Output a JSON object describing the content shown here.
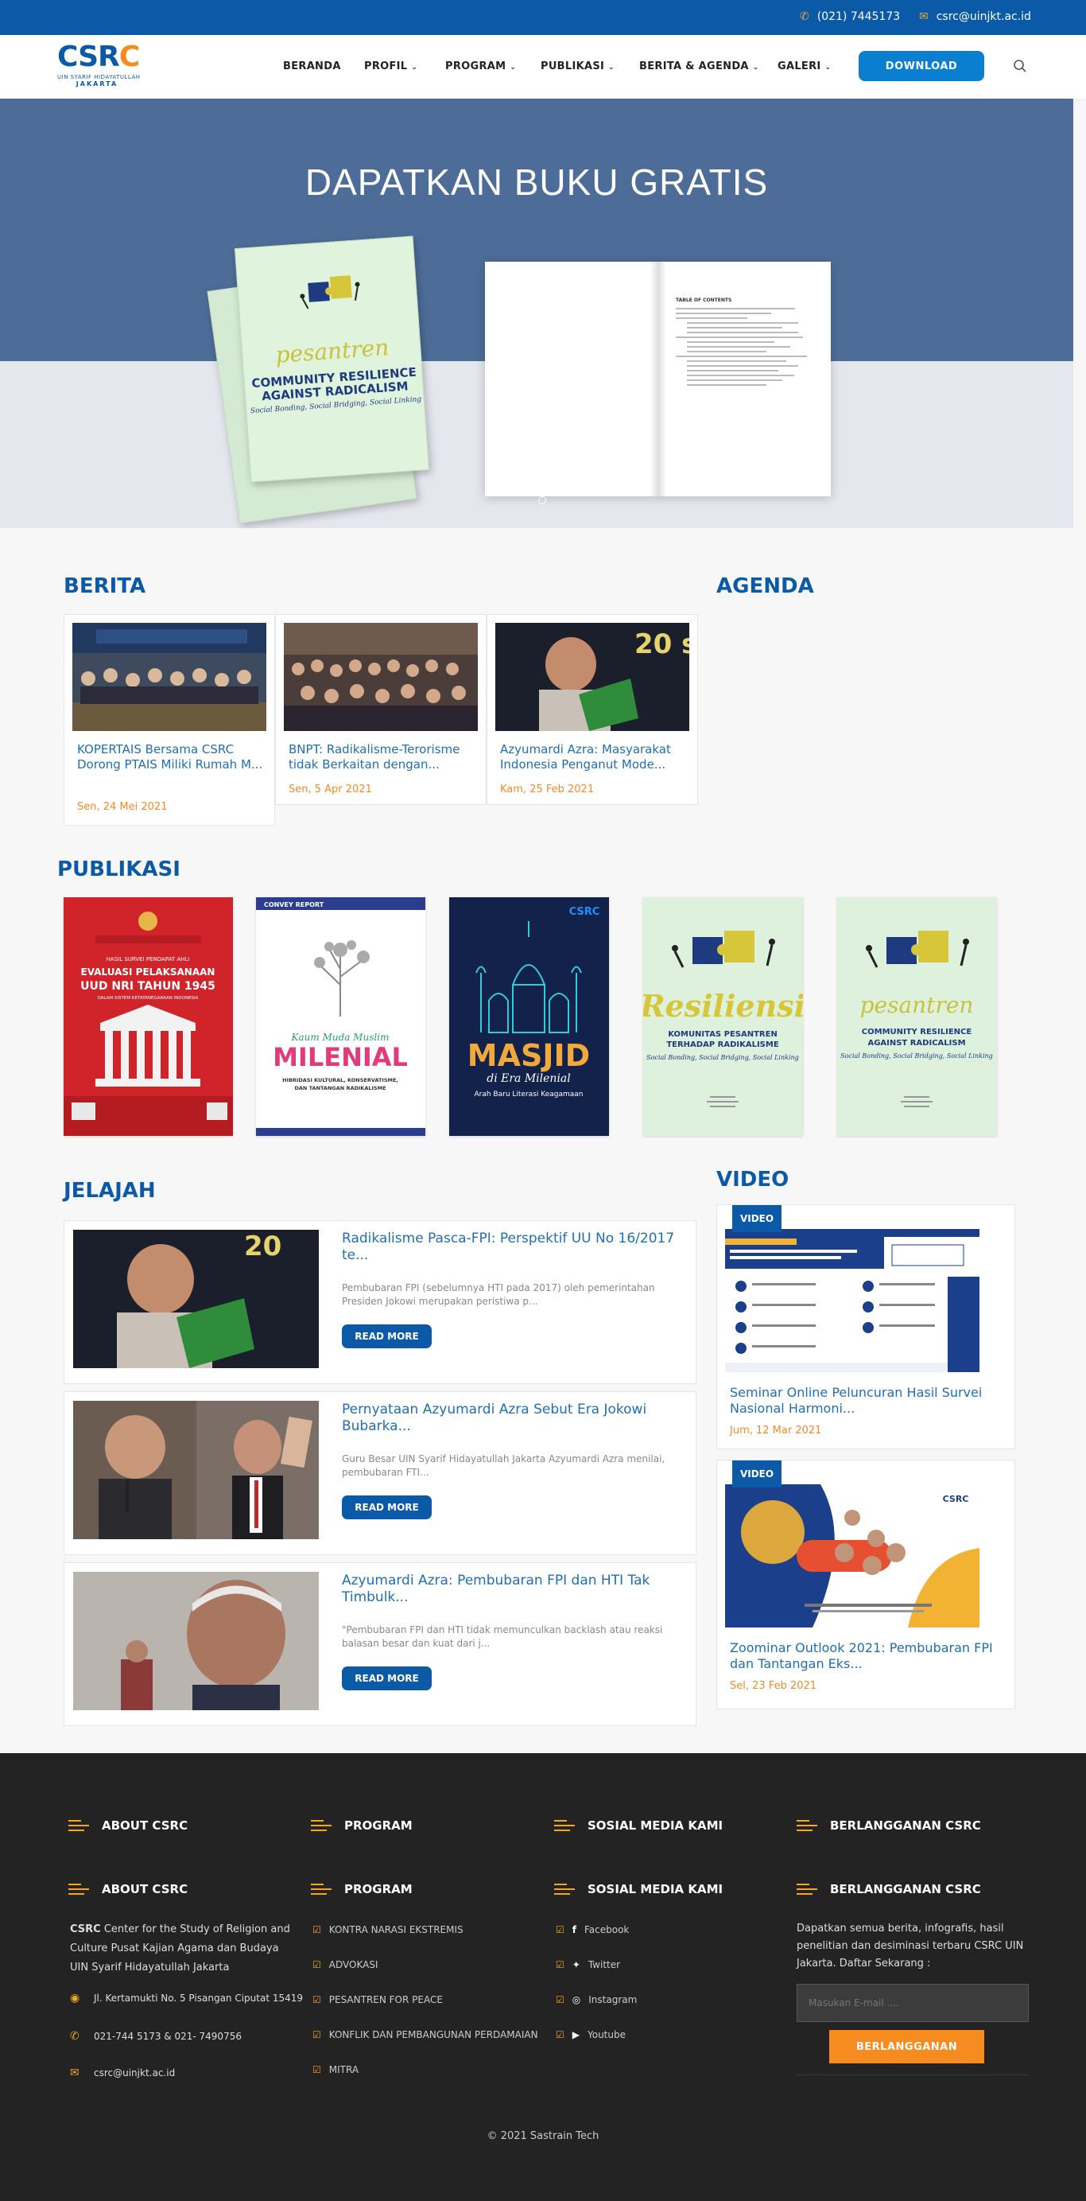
{
  "topbar": {
    "phone": "(021) 7445173",
    "email": "csrc@uinjkt.ac.id"
  },
  "logo": {
    "part1": "CSR",
    "part2": "C",
    "sub": "UIN SYARIF HIDAYATULLAH",
    "sub2": "JAKARTA"
  },
  "nav": {
    "items": [
      {
        "label": "BERANDA",
        "dropdown": false
      },
      {
        "label": "PROFIL",
        "dropdown": true
      },
      {
        "label": "PROGRAM",
        "dropdown": true
      },
      {
        "label": "PUBLIKASI",
        "dropdown": true
      },
      {
        "label": "BERITA & AGENDA",
        "dropdown": true
      },
      {
        "label": "GALERI",
        "dropdown": true
      }
    ],
    "download_label": "DOWNLOAD"
  },
  "hero": {
    "title": "DAPATKAN BUKU GRATIS",
    "book_line1": "pesantren",
    "book_line2": "COMMUNITY RESILIENCE",
    "book_line3": "AGAINST RADICALISM",
    "book_tagline": "Social Bonding, Social Bridging, Social Linking",
    "toc_title": "TABLE OF CONTENTS"
  },
  "berita": {
    "heading": "BERITA",
    "items": [
      {
        "title": "KOPERTAIS Bersama CSRC Dorong PTAIS Miliki Rumah M...",
        "date": "Sen, 24 Mei 2021"
      },
      {
        "title": "BNPT: Radikalisme-Terorisme tidak Berkaitan dengan...",
        "date": "Sen, 5 Apr 2021"
      },
      {
        "title": "Azyumardi Azra: Masyarakat Indonesia Penganut Mode...",
        "date": "Kam, 25 Feb 2021"
      }
    ]
  },
  "agenda": {
    "heading": "AGENDA"
  },
  "publikasi": {
    "heading": "PUBLIKASI",
    "covers": [
      {
        "top": "HASIL SURVEI PENDAPAT AHLI",
        "title": "EVALUASI PELAKSANAAN UUD NRI TAHUN 1945",
        "sub": "DALAM SISTEM KETATANEGARAAN INDONESIA"
      },
      {
        "top": "CONVEY REPORT",
        "title": "MILENIAL",
        "script": "Kaum Muda Muslim",
        "sub": "HIBRIDASI KULTURAL, KONSERVATISME, DAN TANTANGAN RADIKALISME"
      },
      {
        "title": "MASJID",
        "script": "di Era Milenial",
        "sub": "Arah Baru Literasi Keagamaan"
      },
      {
        "title": "Resiliensi",
        "sub": "KOMUNITAS PESANTREN TERHADAP RADIKALISME"
      },
      {
        "title": "pesantren",
        "sub": "COMMUNITY RESILIENCE AGAINST RADICALISM"
      }
    ]
  },
  "jelajah": {
    "heading": "JELAJAH",
    "read_more": "READ MORE",
    "items": [
      {
        "title": "Radikalisme Pasca-FPI: Perspektif UU No 16/2017 te...",
        "excerpt": "Pembubaran FPI (sebelumnya HTI pada 2017) oleh pemerintahan Presiden Jokowi merupakan peristiwa p..."
      },
      {
        "title": "Pernyataan Azyumardi Azra Sebut Era Jokowi Bubarka...",
        "excerpt": "Guru Besar UIN Syarif Hidayatullah Jakarta Azyumardi Azra menilai, pembubaran FTI..."
      },
      {
        "title": "Azyumardi Azra: Pembubaran FPI dan HTI Tak Timbulk...",
        "excerpt": "\"Pembubaran FPI dan HTI tidak memunculkan backlash atau reaksi balasan besar dan kuat dari j..."
      }
    ]
  },
  "video": {
    "heading": "VIDEO",
    "badge": "VIDEO",
    "items": [
      {
        "title": "Seminar Online Peluncuran Hasil Survei Nasional Harmoni...",
        "date": "Jum, 12 Mar 2021"
      },
      {
        "title": "Zoominar Outlook 2021: Pembubaran FPI dan Tantangan Eks...",
        "date": "Sel, 23 Feb 2021"
      }
    ]
  },
  "footer": {
    "headings": [
      "ABOUT CSRC",
      "PROGRAM",
      "SOSIAL MEDIA KAMI",
      "BERLANGGANAN CSRC"
    ],
    "about_bold": "CSRC",
    "about_text": " Center for the Study of Religion and Culture Pusat Kajian Agama dan Budaya UIN Syarif Hidayatullah Jakarta",
    "address": "Jl. Kertamukti No. 5 Pisangan Ciputat 15419",
    "phone": "021-744 5173 & 021- 7490756",
    "email": "csrc@uinjkt.ac.id",
    "programs": [
      "KONTRA NARASI EKSTREMIS",
      "ADVOKASI",
      "PESANTREN FOR PEACE",
      "KONFLIK DAN PEMBANGUNAN PERDAMAIAN",
      "MITRA"
    ],
    "social": [
      "Facebook",
      "Twitter",
      "Instagram",
      "Youtube"
    ],
    "subscribe_text": "Dapatkan semua berita, infografis, hasil penelitian dan desiminasi terbaru CSRC UIN Jakarta. Daftar Sekarang :",
    "subscribe_placeholder": "Masukan E-mail ....",
    "subscribe_button": "BERLANGGANAN",
    "copyright": "© 2021 Sastrain Tech"
  },
  "colors": {
    "primary": "#0b5aa7",
    "accent": "#f68b1f",
    "link": "#1f6fb2",
    "footer_bg": "#232323"
  }
}
